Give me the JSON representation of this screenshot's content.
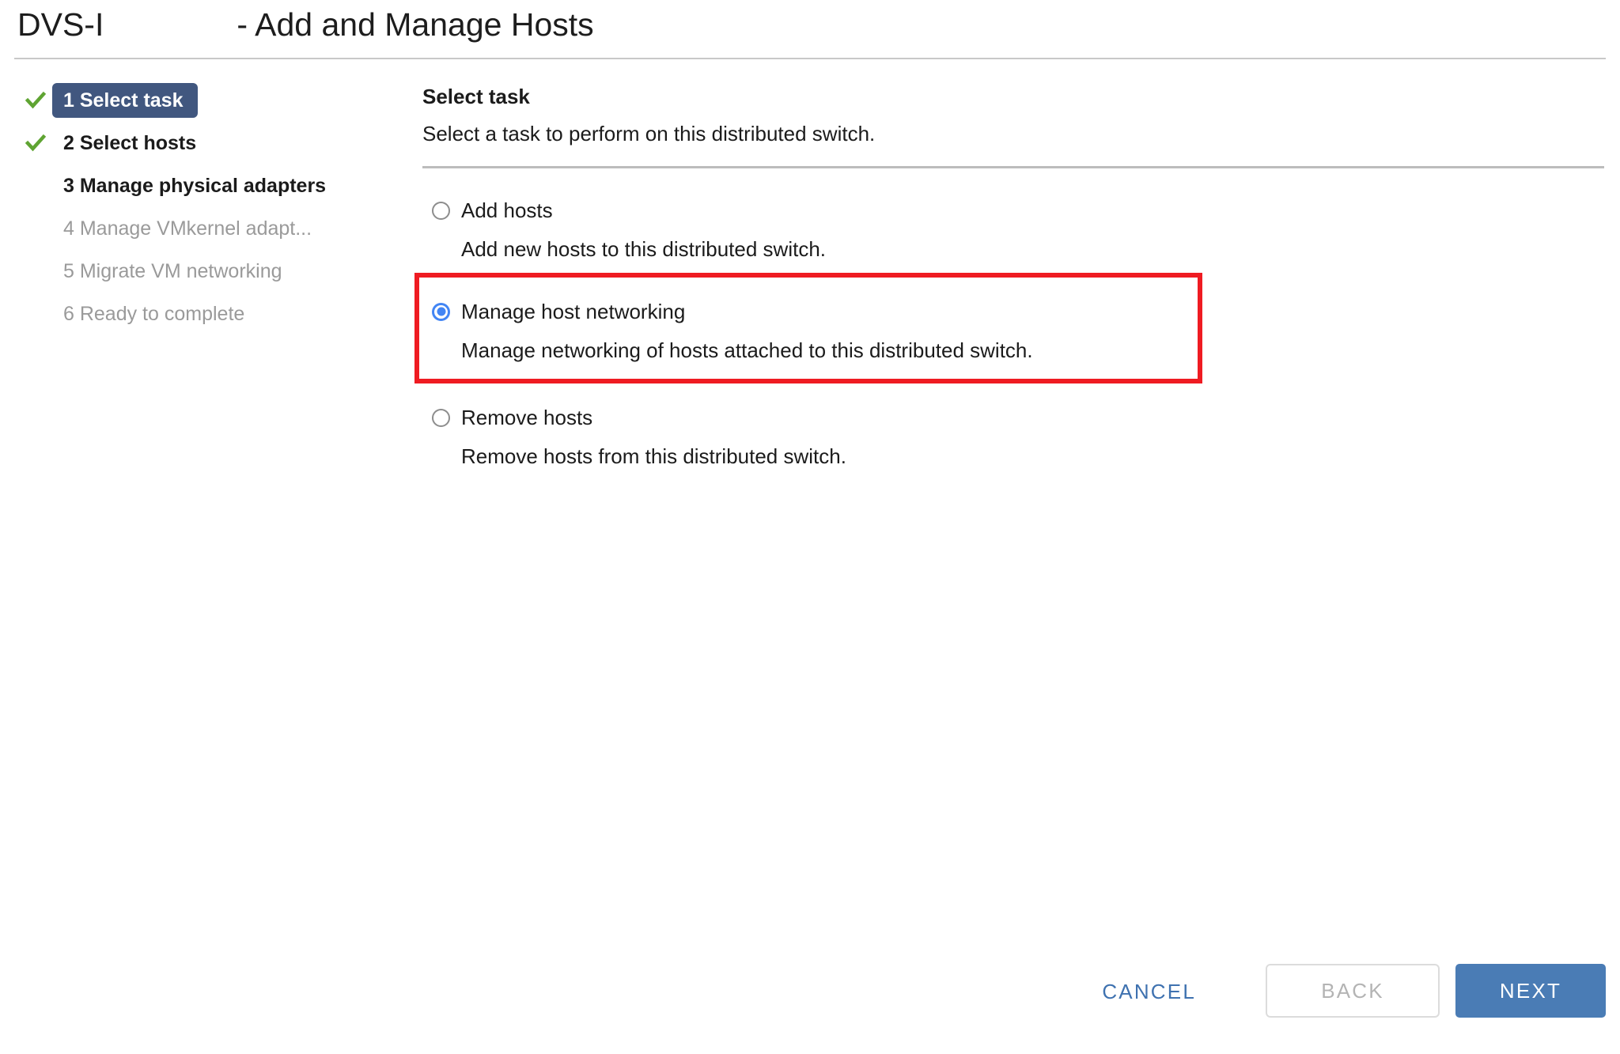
{
  "header": {
    "switch_name": "DVS-I",
    "title_suffix": "- Add and Manage Hosts"
  },
  "sidebar": {
    "steps": [
      {
        "label": "1 Select task",
        "state": "active",
        "checked": true
      },
      {
        "label": "2 Select hosts",
        "state": "done",
        "checked": true
      },
      {
        "label": "3 Manage physical adapters",
        "state": "current",
        "checked": false
      },
      {
        "label": "4 Manage VMkernel adapt...",
        "state": "upcoming",
        "checked": false
      },
      {
        "label": "5 Migrate VM networking",
        "state": "upcoming",
        "checked": false
      },
      {
        "label": "6 Ready to complete",
        "state": "upcoming",
        "checked": false
      }
    ]
  },
  "main": {
    "title": "Select task",
    "subtitle": "Select a task to perform on this distributed switch.",
    "options": [
      {
        "label": "Add hosts",
        "description": "Add new hosts to this distributed switch.",
        "selected": false,
        "highlighted": false
      },
      {
        "label": "Manage host networking",
        "description": "Manage networking of hosts attached to this distributed switch.",
        "selected": true,
        "highlighted": true
      },
      {
        "label": "Remove hosts",
        "description": "Remove hosts from this distributed switch.",
        "selected": false,
        "highlighted": false
      }
    ]
  },
  "footer": {
    "cancel_label": "CANCEL",
    "back_label": "BACK",
    "next_label": "NEXT"
  },
  "colors": {
    "active_step_pill": "#41577f",
    "checkmark_green": "#5fa432",
    "radio_blue": "#4285f4",
    "highlight_red": "#ef1b22",
    "primary_button": "#4a7cb5",
    "link_blue": "#3f72b0"
  }
}
